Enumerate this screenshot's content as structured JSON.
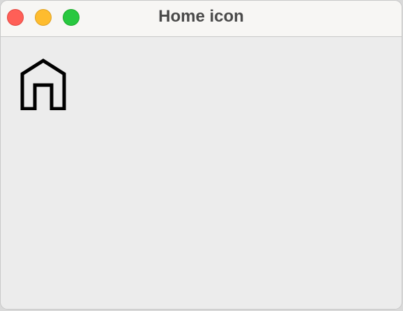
{
  "window": {
    "title": "Home icon",
    "traffic_lights": {
      "close_color": "#ff5f57",
      "minimize_color": "#febc2e",
      "zoom_color": "#28c840"
    }
  },
  "content": {
    "icon": "home-icon"
  }
}
